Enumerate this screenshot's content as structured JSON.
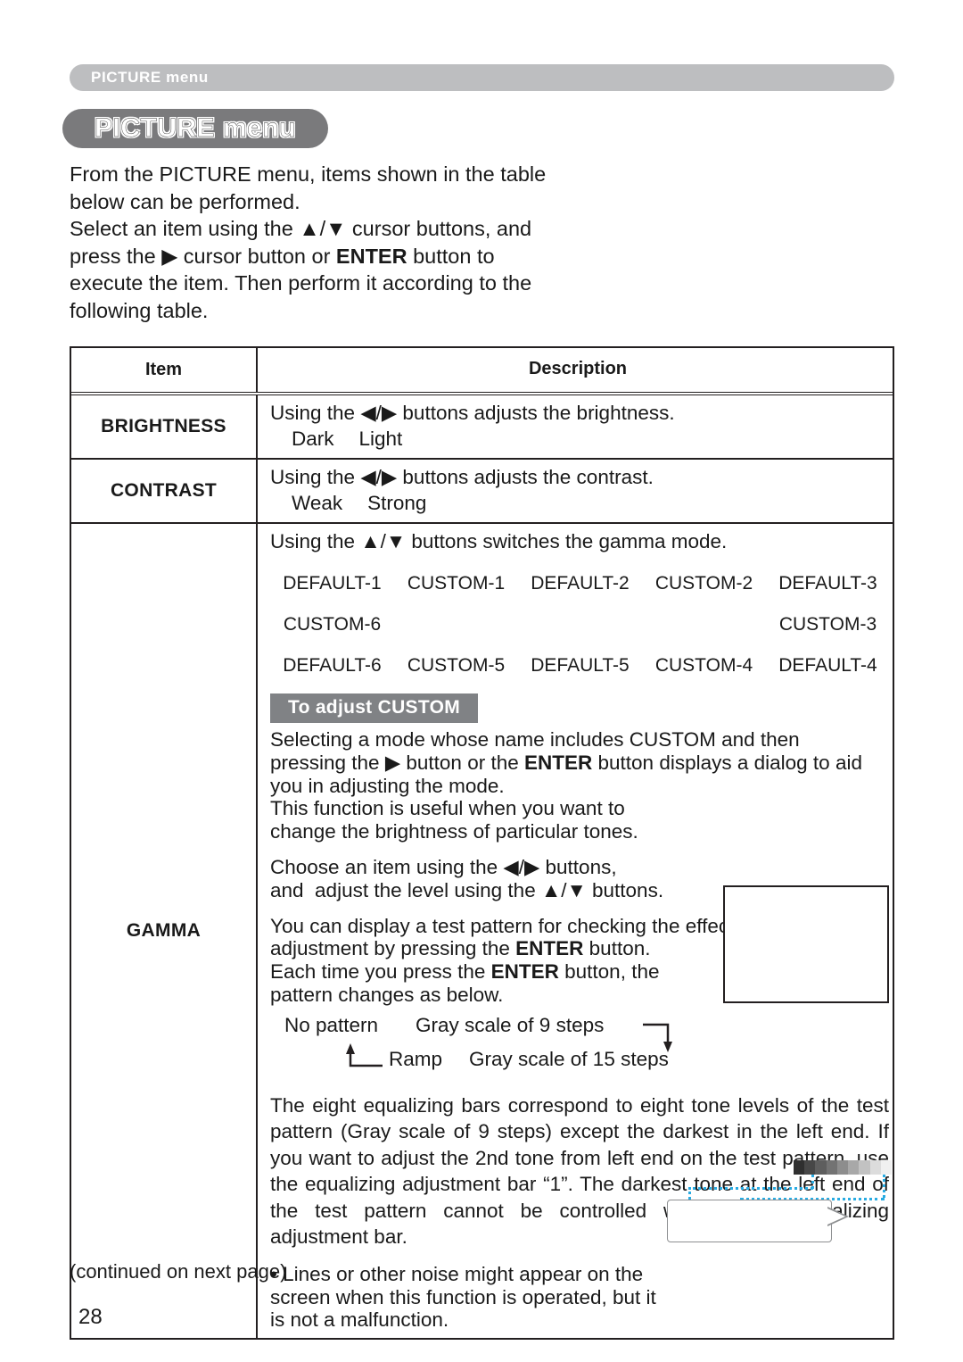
{
  "running_header": {
    "text": "PICTURE menu"
  },
  "title_pill": {
    "text": "PICTURE menu"
  },
  "intro": {
    "line1": "From the PICTURE menu, items shown in the table",
    "line2": "below can be performed.",
    "line3_a": "Select an item using the ",
    "line3_icons": "▲/▼",
    "line3_b": " cursor buttons, and",
    "line4_a": "press the ",
    "line4_icon": "▶",
    "line4_b": " cursor button or ",
    "line4_bold": "ENTER",
    "line4_c": " button to",
    "line5": "execute the item. Then perform it according to the",
    "line6": "following table."
  },
  "table": {
    "header": {
      "item": "Item",
      "description": "Description"
    },
    "brightness": {
      "item": "BRIGHTNESS",
      "line1_a": "Using the ",
      "line1_icons": "◀/▶",
      "line1_b": " buttons adjusts the brightness.",
      "low": "Dark",
      "high": "Light"
    },
    "contrast": {
      "item": "CONTRAST",
      "line1_a": "Using the ",
      "line1_icons": "◀/▶",
      "line1_b": " buttons adjusts the contrast.",
      "low": "Weak",
      "high": "Strong"
    },
    "gamma": {
      "item": "GAMMA",
      "intro_a": "Using the ",
      "intro_icons": "▲/▼",
      "intro_b": " buttons switches the gamma mode.",
      "modes": {
        "row1": [
          "DEFAULT-1",
          "CUSTOM-1",
          "DEFAULT-2",
          "CUSTOM-2",
          "DEFAULT-3"
        ],
        "row2": [
          "CUSTOM-6",
          "",
          "",
          "",
          "CUSTOM-3"
        ],
        "row3": [
          "DEFAULT-6",
          "CUSTOM-5",
          "DEFAULT-5",
          "CUSTOM-4",
          "DEFAULT-4"
        ]
      },
      "banner": "To adjust CUSTOM",
      "p1_a": "Selecting a mode whose name includes CUSTOM and then",
      "p1_b_pre": "pressing the ",
      "p1_b_icon": "▶",
      "p1_b_mid": " button or the ",
      "p1_b_bold": "ENTER",
      "p1_b_post": " button displays a dialog to aid",
      "p1_c": "you in adjusting the mode.",
      "p1_d": "This function is useful when you want to",
      "p1_e": "change the brightness of particular tones.",
      "p2_a_pre": "Choose an item using the ",
      "p2_a_icons": "◀/▶",
      "p2_a_post": " buttons,",
      "p2_b_pre": "and  adjust the level using the ",
      "p2_b_icons": "▲/▼",
      "p2_b_post": " buttons.",
      "p3_a": "You can display a test pattern for checking the effect of your",
      "p3_b_pre": "adjustment by pressing the ",
      "p3_b_bold": "ENTER",
      "p3_b_post": " button.",
      "p3_c_pre": "Each time you press the ",
      "p3_c_bold": "ENTER",
      "p3_c_post": " button, the",
      "p3_d": "pattern changes as below.",
      "cycle": {
        "no_pattern": "No pattern",
        "gray9": "Gray scale of 9 steps",
        "ramp": "Ramp",
        "gray15": "Gray scale of 15 steps"
      },
      "p4": "The eight equalizing bars correspond to eight tone levels of the test pattern (Gray scale of 9 steps) except the darkest in the left end. If you want to adjust the 2nd tone from left end on the test pattern, use the equalizing adjustment bar “1”. The darkest tone at the left end of the test pattern cannot be controlled with any of equalizing adjustment bar.",
      "p5_a": "• Lines or other noise might appear on the",
      "p5_b": "screen when this function is operated, but it",
      "p5_c": "is not a malfunction."
    }
  },
  "footer": {
    "continued": "(continued on next page)",
    "page_number": "28"
  },
  "colors": {
    "header_band": "#bdbec0",
    "title_pill": "#7a7a7c",
    "banner": "#808285",
    "callout_line": "#29abe2",
    "rule": "#231f20",
    "gradient_steps": [
      "#2f2f2f",
      "#474747",
      "#5e5e5e",
      "#737373",
      "#8d8d8d",
      "#a8a8a8",
      "#c2c2c2",
      "#dcdcdc",
      "#f0f0f0"
    ]
  }
}
